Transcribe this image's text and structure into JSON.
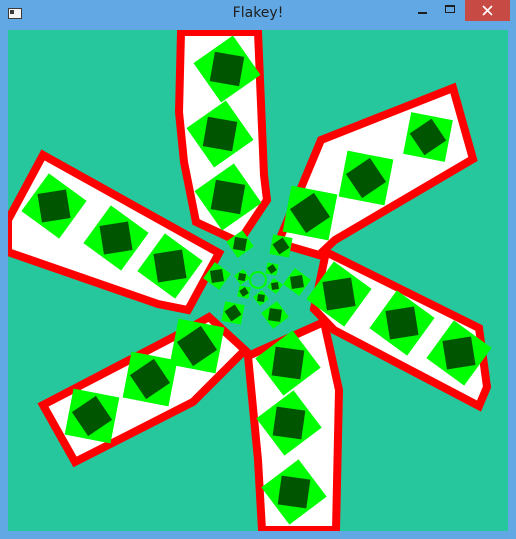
{
  "window": {
    "title": "Flakey!",
    "controls": {
      "minimize": "minimize-icon",
      "maximize": "maximize-icon",
      "close": "close-icon"
    }
  },
  "game": {
    "colors": {
      "background": "#26c79d",
      "arm_fill": "#ffffff",
      "arm_border": "#ff0000",
      "diamond_outer": "#00ff00",
      "diamond_inner": "#005500",
      "center_dot": "#26c79d"
    }
  }
}
